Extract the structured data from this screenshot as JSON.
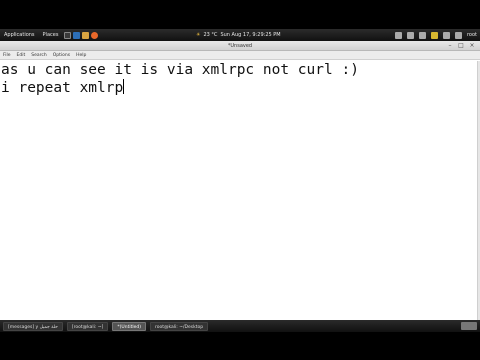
{
  "top_panel": {
    "applications": "Applications",
    "places": "Places",
    "weather": "23 °C",
    "clock": "Sun Aug 17,  9:29:25 PM",
    "user": "root"
  },
  "window": {
    "title": "*Unsaved",
    "controls": [
      "–",
      "□",
      "×"
    ]
  },
  "menubar": [
    "File",
    "Edit",
    "Search",
    "Options",
    "Help"
  ],
  "editor": {
    "lines": [
      "as u can see it is via xmlrpc not curl :)",
      "i repeat xmlrp"
    ]
  },
  "taskbar": {
    "items": [
      {
        "label": "[messages] y حلة جميل"
      },
      {
        "label": "[root@kali: ~]"
      },
      {
        "label": "*(Untitled)"
      },
      {
        "label": "root@kali: ~/Desktop"
      }
    ]
  },
  "colors": {
    "panel": "#1c1c1c",
    "editor_bg": "#ffffff",
    "text": "#111111"
  }
}
